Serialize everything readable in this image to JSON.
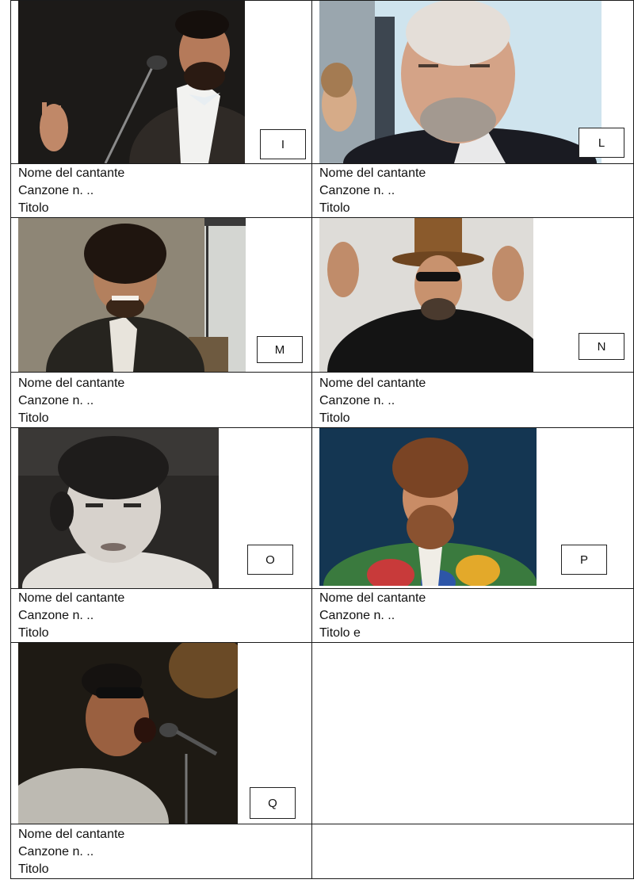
{
  "cards": [
    {
      "letter": "I",
      "name_label": "Nome del cantante",
      "song_label": "Canzone n. ..",
      "title_label": "Titolo"
    },
    {
      "letter": "L",
      "name_label": "Nome del cantante",
      "song_label": "Canzone n. ..",
      "title_label": "Titolo"
    },
    {
      "letter": "M",
      "name_label": "Nome del cantante",
      "song_label": "Canzone n. ..",
      "title_label": "Titolo"
    },
    {
      "letter": "N",
      "name_label": "Nome del cantante",
      "song_label": "Canzone n. ..",
      "title_label": "Titolo"
    },
    {
      "letter": "O",
      "name_label": "Nome del cantante",
      "song_label": "Canzone n. ..",
      "title_label": "Titolo"
    },
    {
      "letter": "P",
      "name_label": "Nome del cantante",
      "song_label": "Canzone n. ..",
      "title_label": "Titolo e"
    },
    {
      "letter": "Q",
      "name_label": "Nome del cantante",
      "song_label": "Canzone n. ..",
      "title_label": "Titolo"
    }
  ]
}
